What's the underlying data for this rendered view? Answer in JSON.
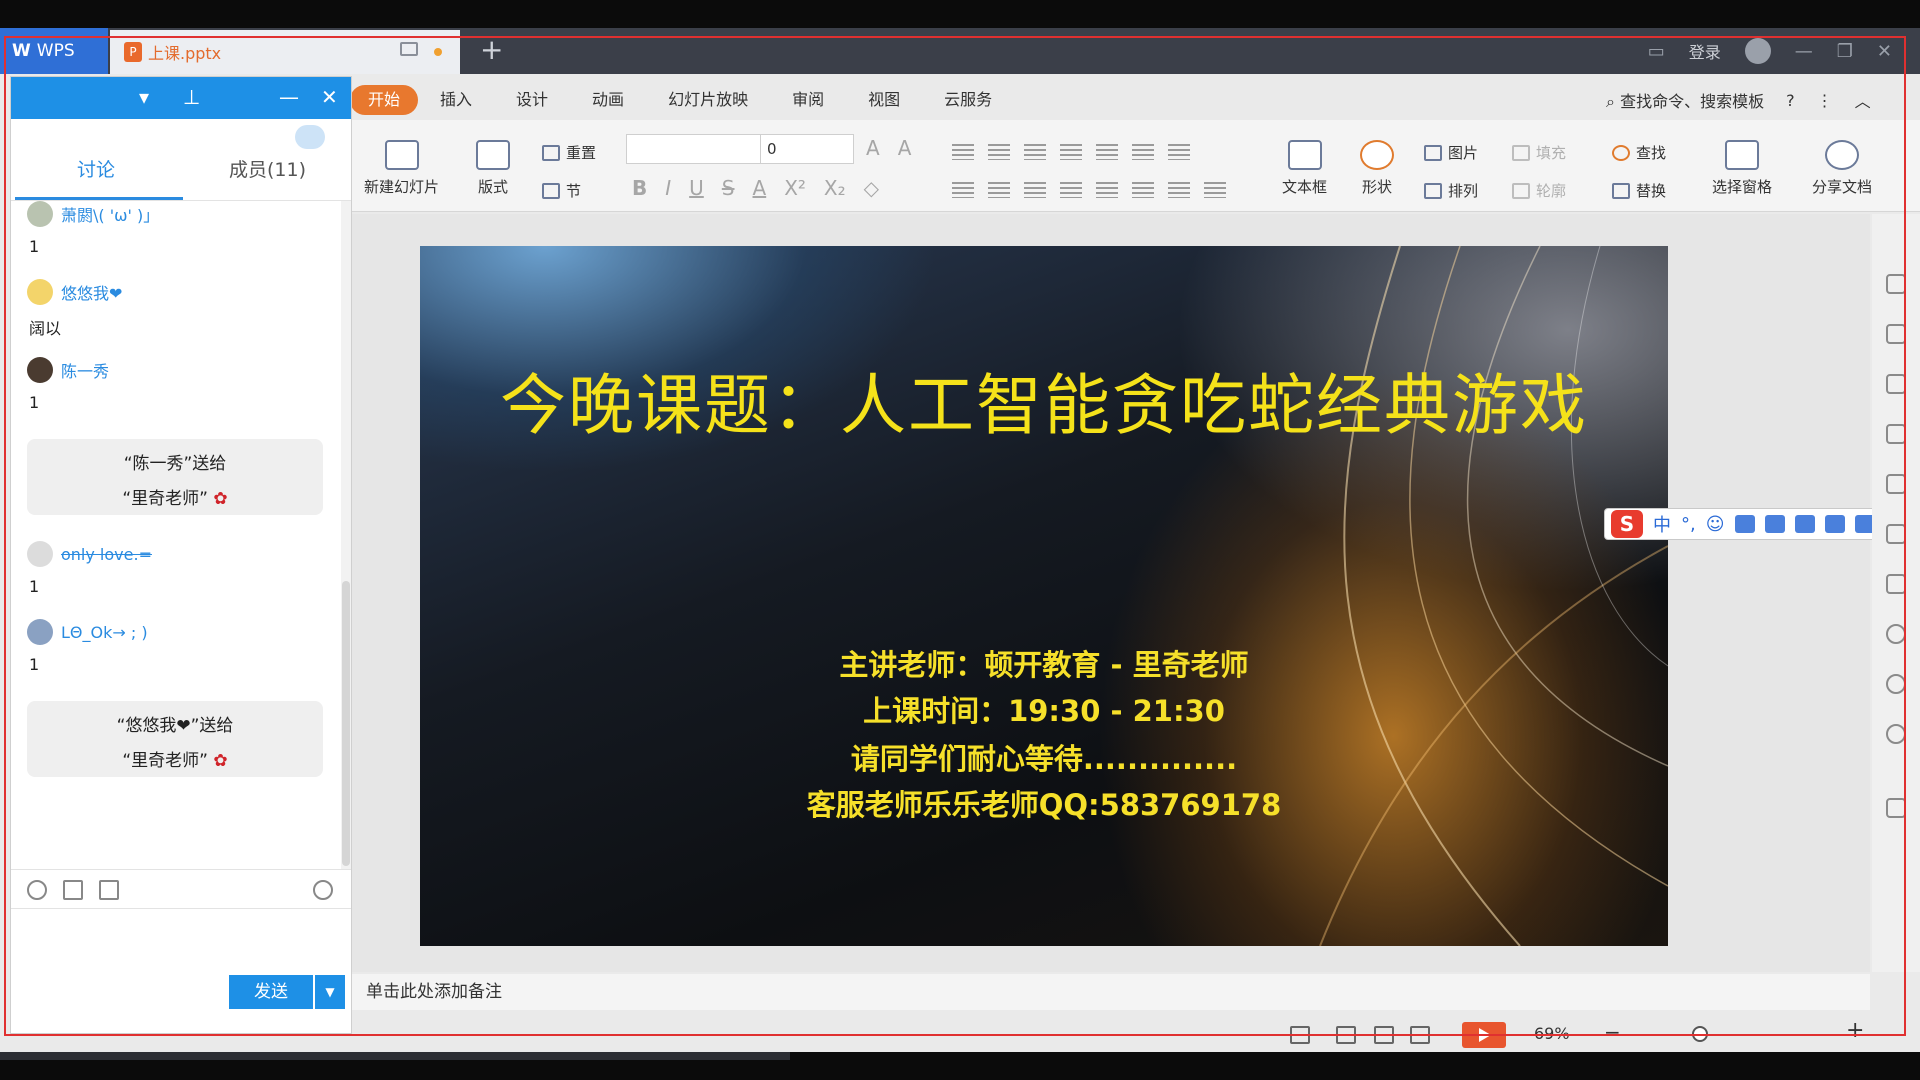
{
  "titlebar": {
    "app_tab": "WPS",
    "doc_tab": "上课.pptx",
    "add_tab": "+",
    "login": "登录"
  },
  "menu": {
    "tabs": [
      "开始",
      "插入",
      "设计",
      "动画",
      "幻灯片放映",
      "审阅",
      "视图",
      "云服务"
    ],
    "search": "查找命令、搜索模板",
    "help": "?"
  },
  "ribbon": {
    "new_slide": "新建幻灯片",
    "layout": "版式",
    "reset": "重置",
    "section": "节",
    "font_size": "0",
    "textbox": "文本框",
    "shape": "形状",
    "picture": "图片",
    "arrange": "排列",
    "fill": "填充",
    "outline": "轮廓",
    "find": "查找",
    "replace": "替换",
    "select_pane": "选择窗格",
    "share": "分享文档"
  },
  "slide": {
    "title": "今晚课题：人工智能贪吃蛇经典游戏",
    "line1": "主讲老师：顿开教育 - 里奇老师",
    "line2": "上课时间：19:30 - 21:30",
    "line3": "请同学们耐心等待..............",
    "line4": "客服老师乐乐老师QQ:583769178"
  },
  "ime": {
    "mode": "中"
  },
  "notes": {
    "placeholder": "单击此处添加备注"
  },
  "status": {
    "zoom": "69%"
  },
  "chat": {
    "tab_discuss": "讨论",
    "tab_members": "成员(11)",
    "messages": [
      {
        "name": "萧閼\\( 'ω' )」",
        "text": "1"
      },
      {
        "name": "悠悠我❤",
        "text": "阔以"
      },
      {
        "name": "陈一秀",
        "text": "1"
      },
      {
        "name": "only love.=",
        "text": "1"
      },
      {
        "name": "LΘ_Ok→ ; )",
        "text": "1"
      }
    ],
    "gifts": [
      {
        "line1": "“陈一秀”送给",
        "line2": "“里奇老师”"
      },
      {
        "line1": "“悠悠我❤”送给",
        "line2": "“里奇老师”"
      }
    ],
    "send": "发送"
  },
  "colors": {
    "accent_blue": "#1e90e6",
    "ribbon_tab_active": "#e8782e",
    "slide_text": "#f5e21a",
    "record_border": "#e03030"
  }
}
